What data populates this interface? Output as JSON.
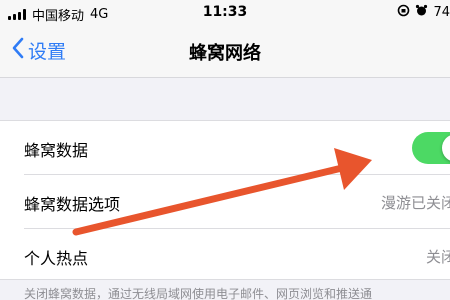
{
  "status_bar": {
    "carrier": "中国移动",
    "network": "4G",
    "time": "11:33",
    "battery": "74"
  },
  "nav": {
    "back_label": "设置",
    "title": "蜂窝网络"
  },
  "settings": {
    "cellular_data": {
      "label": "蜂窝数据",
      "enabled": true
    },
    "cellular_options": {
      "label": "蜂窝数据选项",
      "value": "漫游已关闭"
    },
    "hotspot": {
      "label": "个人热点",
      "value": "关闭"
    }
  },
  "footer_text": "关闭蜂窝数据，通过无线局域网使用电子邮件、网页浏览和推送通",
  "colors": {
    "accent": "#2f7cf6",
    "toggle_on": "#4cd964",
    "annotation_arrow": "#e8552d"
  }
}
